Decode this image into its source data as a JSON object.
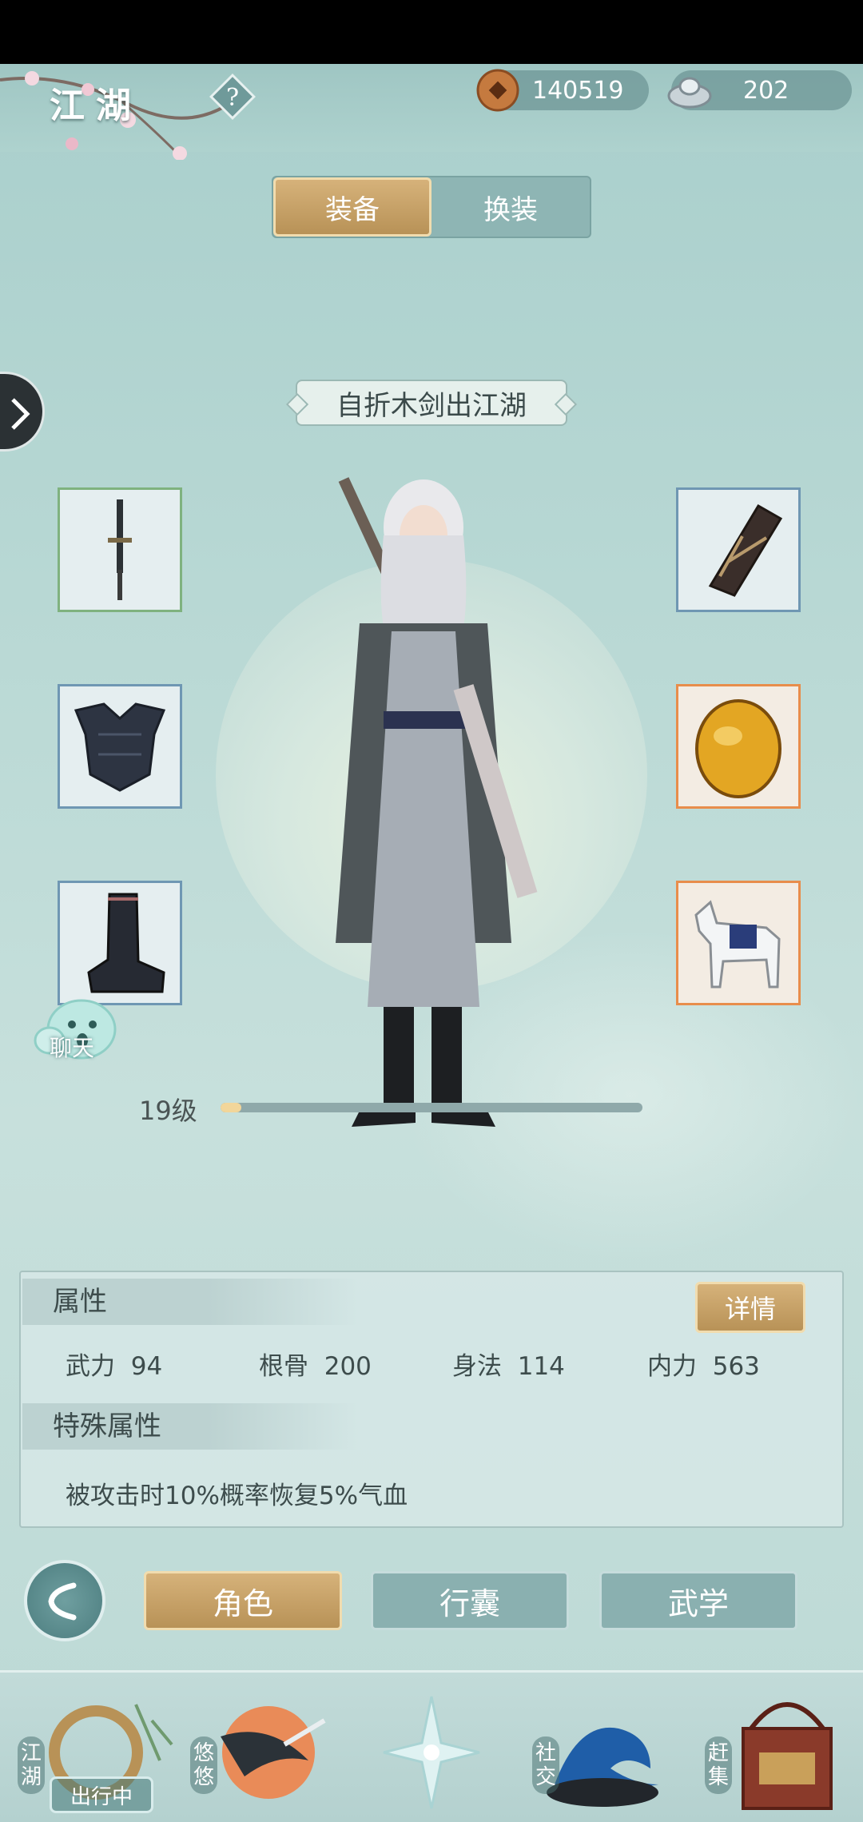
{
  "header": {
    "title": "江湖",
    "copper": "140519",
    "silver": "202"
  },
  "tabs": [
    {
      "label": "装备",
      "active": true
    },
    {
      "label": "换装",
      "active": false
    }
  ],
  "character": {
    "nickname": "自折木剑出江湖",
    "level_label": "19级",
    "level_progress": 0.05
  },
  "equipment": {
    "left": [
      "sword",
      "armor",
      "boots"
    ],
    "right": [
      "bracer",
      "amber-gem",
      "horse"
    ]
  },
  "chat": {
    "label": "聊天"
  },
  "attributes": {
    "section_title": "属性",
    "detail_button": "详情",
    "stats": [
      {
        "name": "武力",
        "value": "94"
      },
      {
        "name": "根骨",
        "value": "200"
      },
      {
        "name": "身法",
        "value": "114"
      },
      {
        "name": "内力",
        "value": "563"
      }
    ],
    "special_title": "特殊属性",
    "special_text": "被攻击时10%概率恢复5%气血"
  },
  "nav": {
    "buttons": [
      {
        "label": "角色",
        "active": true
      },
      {
        "label": "行囊",
        "active": false
      },
      {
        "label": "武学",
        "active": false
      }
    ]
  },
  "dock": {
    "items": [
      {
        "label": "江湖",
        "badge": "出行中"
      },
      {
        "label": "悠悠"
      },
      {
        "label": ""
      },
      {
        "label": "社交"
      },
      {
        "label": "赶集"
      }
    ]
  },
  "colors": {
    "gold_button": "#c9a468",
    "teal_button": "#8ab0b0",
    "background": "#b8d8d4"
  }
}
